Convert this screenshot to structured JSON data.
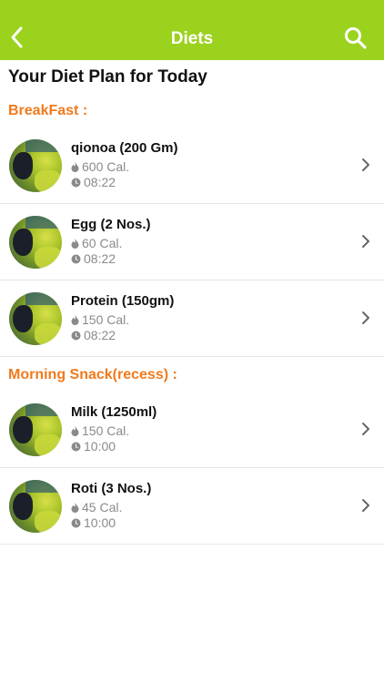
{
  "header": {
    "title": "Diets",
    "back_icon": "chevron-left-icon",
    "search_icon": "search-icon",
    "bg_color": "#9bd21e"
  },
  "page_title": "Your Diet Plan for Today",
  "accent_color": "#f07a1c",
  "sections": [
    {
      "title": "BreakFast :",
      "items": [
        {
          "name": "qionoa (200 Gm)",
          "calories": "600 Cal.",
          "time": "08:22"
        },
        {
          "name": "Egg (2 Nos.)",
          "calories": "60 Cal.",
          "time": "08:22"
        },
        {
          "name": "Protein (150gm)",
          "calories": "150 Cal.",
          "time": "08:22"
        }
      ]
    },
    {
      "title": "Morning Snack(recess) :",
      "items": [
        {
          "name": "Milk (1250ml)",
          "calories": "150 Cal.",
          "time": "10:00"
        },
        {
          "name": "Roti (3 Nos.)",
          "calories": "45 Cal.",
          "time": "10:00"
        }
      ]
    }
  ]
}
